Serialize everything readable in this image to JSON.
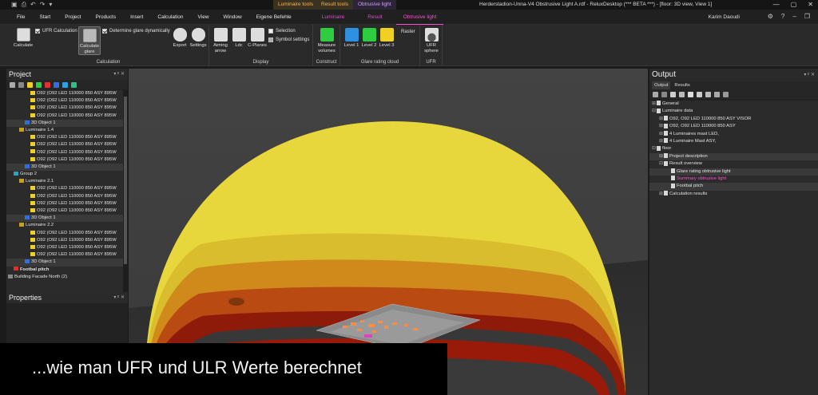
{
  "colors": {
    "accent_pink": "#ff4fd0",
    "context_orange": "#ffb347",
    "dome_yellow": "#e6d23a",
    "dome_red": "#9a1a0a",
    "viewport_bg": "#3e3e3e"
  },
  "titlebar": {
    "context_tabs": [
      "Luminaire tools",
      "Result tools",
      "Obtrusive light"
    ],
    "document_title": "Herderstadion-Unna-V4 Obstrusive Light A.rdf - ReluxDesktop (*** BETA ***) - [floor: 3D view, View 1]"
  },
  "menu": {
    "items": [
      "File",
      "Start",
      "Project",
      "Products",
      "Insert",
      "Calculation",
      "View",
      "Window",
      "Eigene Befehle"
    ],
    "context_items": [
      "Luminaire",
      "Result",
      "Obtrusive light"
    ],
    "user": "Karim Daoudi"
  },
  "ribbon": {
    "calculation": {
      "label": "Calculation",
      "calculate": "Calculate",
      "ufr_calculation": "UFR Calculation",
      "calculate_glare": "Calculate glare",
      "determine_glare": "Determine glare dynamically"
    },
    "display": {
      "label": "Display",
      "export": "Export",
      "settings": "Settings",
      "aiming_arrow": "Aiming arrow",
      "ldc": "Ldc",
      "c_planes": "C-Planes",
      "selection": "Selection",
      "symbol_settings": "Symbol settings"
    },
    "construct": {
      "label": "Construct",
      "measure_volumes": "Measure volumes"
    },
    "glare_cloud": {
      "label": "Glare rating cloud",
      "level1": "Level 1",
      "level2": "Level 2",
      "level3": "Level 3",
      "raster": "Raster"
    },
    "ufr": {
      "label": "UFR",
      "ufr_sphere": "UFR sphere"
    }
  },
  "project": {
    "title": "Project",
    "rows": [
      {
        "indent": 4,
        "text": "O92 (O92 LED 110000 850 ASY 895W",
        "type": "lum"
      },
      {
        "indent": 4,
        "text": "O92 (O92 LED 110000 850 ASY 895W",
        "type": "lum"
      },
      {
        "indent": 4,
        "text": "O92 (O92 LED 110000 850 ASY 895W",
        "type": "lum"
      },
      {
        "indent": 4,
        "text": "O92 (O92 LED 110000 850 ASY 895W",
        "type": "lum"
      },
      {
        "indent": 3,
        "text": "3D Object  1",
        "type": "obj"
      },
      {
        "indent": 2,
        "text": "Luminaire  1.4",
        "type": "group"
      },
      {
        "indent": 4,
        "text": "O92 (O92 LED 110000 850 ASY 895W",
        "type": "lum"
      },
      {
        "indent": 4,
        "text": "O92 (O92 LED 110000 850 ASY 895W",
        "type": "lum"
      },
      {
        "indent": 4,
        "text": "O92 (O92 LED 110000 850 ASY 895W",
        "type": "lum"
      },
      {
        "indent": 4,
        "text": "O92 (O92 LED 110000 850 ASY 895W",
        "type": "lum"
      },
      {
        "indent": 3,
        "text": "3D Object  1",
        "type": "obj"
      },
      {
        "indent": 1,
        "text": "Group  2",
        "type": "grp2"
      },
      {
        "indent": 2,
        "text": "Luminaire  2.1",
        "type": "group"
      },
      {
        "indent": 4,
        "text": "O92 (O92 LED 110000 850 ASY 895W",
        "type": "lum"
      },
      {
        "indent": 4,
        "text": "O92 (O92 LED 110000 850 ASY 895W",
        "type": "lum"
      },
      {
        "indent": 4,
        "text": "O92 (O92 LED 110000 850 ASY 895W",
        "type": "lum"
      },
      {
        "indent": 4,
        "text": "O92 (O92 LED 110000 850 ASY 895W",
        "type": "lum"
      },
      {
        "indent": 3,
        "text": "3D Object  1",
        "type": "obj"
      },
      {
        "indent": 2,
        "text": "Luminaire  2.2",
        "type": "group"
      },
      {
        "indent": 4,
        "text": "O92 (O92 LED 110000 850 ASY 895W",
        "type": "lum"
      },
      {
        "indent": 4,
        "text": "O92 (O92 LED 110000 850 ASY 895W",
        "type": "lum"
      },
      {
        "indent": 4,
        "text": "O92 (O92 LED 110000 850 ASY 895W",
        "type": "lum"
      },
      {
        "indent": 4,
        "text": "O92 (O92 LED 110000 850 ASY 895W",
        "type": "lum"
      },
      {
        "indent": 3,
        "text": "3D Object  1",
        "type": "obj"
      },
      {
        "indent": 1,
        "text": "Footbal pitch",
        "type": "pitch"
      },
      {
        "indent": 0,
        "text": "Building Facade North (2)",
        "type": "bld"
      }
    ]
  },
  "properties": {
    "title": "Properties"
  },
  "output": {
    "title": "Output",
    "tabs": [
      "Output",
      "Results"
    ],
    "rows": [
      {
        "indent": 0,
        "text": "General",
        "exp": "+",
        "hl": false,
        "pink": false
      },
      {
        "indent": 0,
        "text": "Luminaire data",
        "exp": "-",
        "hl": false,
        "pink": false
      },
      {
        "indent": 1,
        "text": "O92, O92 LED 110000 850 ASY VISOR",
        "exp": "+",
        "hl": false,
        "pink": false
      },
      {
        "indent": 1,
        "text": "O92, O92 LED 110000 850 ASY",
        "exp": "+",
        "hl": false,
        "pink": false
      },
      {
        "indent": 1,
        "text": "4 Luminaires mast LED,",
        "exp": "+",
        "hl": false,
        "pink": false
      },
      {
        "indent": 1,
        "text": "4 Luminaire Mast ASY,",
        "exp": "+",
        "hl": false,
        "pink": false
      },
      {
        "indent": 0,
        "text": "floor",
        "exp": "-",
        "hl": false,
        "pink": false
      },
      {
        "indent": 1,
        "text": "Project description",
        "exp": "+",
        "hl": true,
        "pink": false
      },
      {
        "indent": 1,
        "text": "Result overview",
        "exp": "-",
        "hl": false,
        "pink": false
      },
      {
        "indent": 2,
        "text": "Glare rating obtrusive light",
        "exp": "",
        "hl": true,
        "pink": false
      },
      {
        "indent": 2,
        "text": "Summary obtrusive light",
        "exp": "",
        "hl": false,
        "pink": true
      },
      {
        "indent": 2,
        "text": "Footbal pitch",
        "exp": "",
        "hl": true,
        "pink": false
      },
      {
        "indent": 1,
        "text": "Calculation results",
        "exp": "+",
        "hl": false,
        "pink": false
      }
    ]
  },
  "caption": "...wie man UFR und ULR Werte berechnet"
}
